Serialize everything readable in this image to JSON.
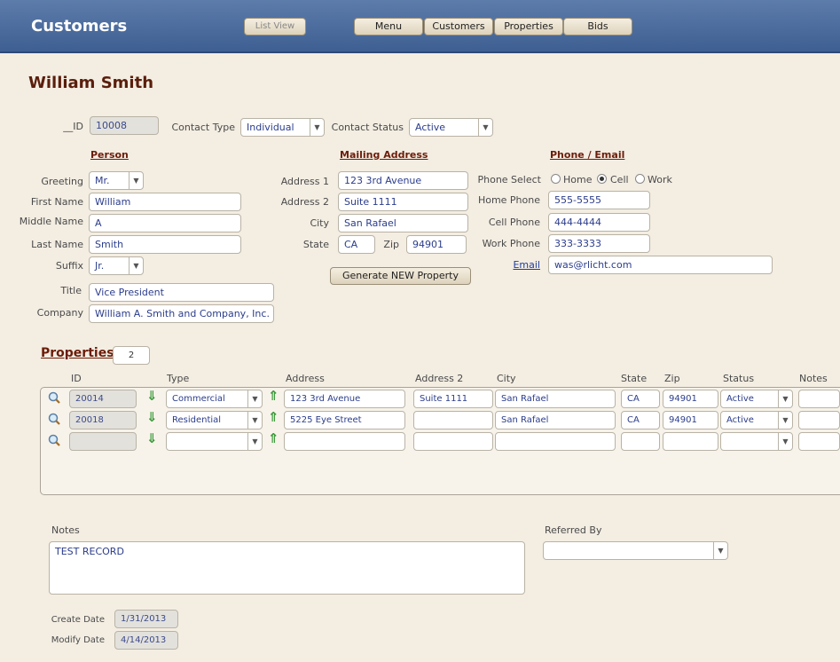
{
  "header": {
    "title": "Customers",
    "list_view": "List View",
    "nav": [
      "Menu",
      "Customers",
      "Properties",
      "Bids"
    ]
  },
  "record": {
    "title": "William Smith",
    "id_label": "__ID",
    "id": "10008",
    "contact_type_label": "Contact Type",
    "contact_type": "Individual",
    "contact_status_label": "Contact Status",
    "contact_status": "Active"
  },
  "person": {
    "heading": "Person",
    "greeting_label": "Greeting",
    "greeting": "Mr.",
    "first_label": "First Name",
    "first": "William",
    "middle_label": "Middle Name",
    "middle": "A",
    "last_label": "Last Name",
    "last": "Smith",
    "suffix_label": "Suffix",
    "suffix": "Jr.",
    "title_label": "Title",
    "title": "Vice President",
    "company_label": "Company",
    "company": "William A. Smith and Company, Inc."
  },
  "mailing": {
    "heading": "Mailing Address",
    "addr1_label": "Address 1",
    "addr1": "123 3rd Avenue",
    "addr2_label": "Address 2",
    "addr2": "Suite 1111",
    "city_label": "City",
    "city": "San Rafael",
    "state_label": "State",
    "state": "CA",
    "zip_label": "Zip",
    "zip": "94901",
    "generate_button": "Generate NEW Property"
  },
  "phone": {
    "heading": "Phone / Email",
    "select_label": "Phone Select",
    "options": [
      "Home",
      "Cell",
      "Work"
    ],
    "selected": "Cell",
    "home_label": "Home Phone",
    "home": "555-5555",
    "cell_label": "Cell Phone",
    "cell": "444-4444",
    "work_label": "Work Phone",
    "work": "333-3333",
    "email_label": "Email",
    "email": "was@rlicht.com"
  },
  "properties": {
    "heading": "Properties",
    "count": "2",
    "columns": [
      "ID",
      "Type",
      "Address",
      "Address 2",
      "City",
      "State",
      "Zip",
      "Status",
      "Notes"
    ],
    "rows": [
      {
        "id": "20014",
        "type": "Commercial",
        "address": "123 3rd Avenue",
        "address2": "Suite 1111",
        "city": "San Rafael",
        "state": "CA",
        "zip": "94901",
        "status": "Active",
        "notes": ""
      },
      {
        "id": "20018",
        "type": "Residential",
        "address": "5225 Eye Street",
        "address2": "",
        "city": "San Rafael",
        "state": "CA",
        "zip": "94901",
        "status": "Active",
        "notes": ""
      },
      {
        "id": "",
        "type": "",
        "address": "",
        "address2": "",
        "city": "",
        "state": "",
        "zip": "",
        "status": "",
        "notes": ""
      }
    ]
  },
  "notes": {
    "label": "Notes",
    "value": "TEST RECORD"
  },
  "referred": {
    "label": "Referred By",
    "value": ""
  },
  "dates": {
    "create_label": "Create Date",
    "create": "1/31/2013",
    "modify_label": "Modify Date",
    "modify": "4/14/2013"
  }
}
